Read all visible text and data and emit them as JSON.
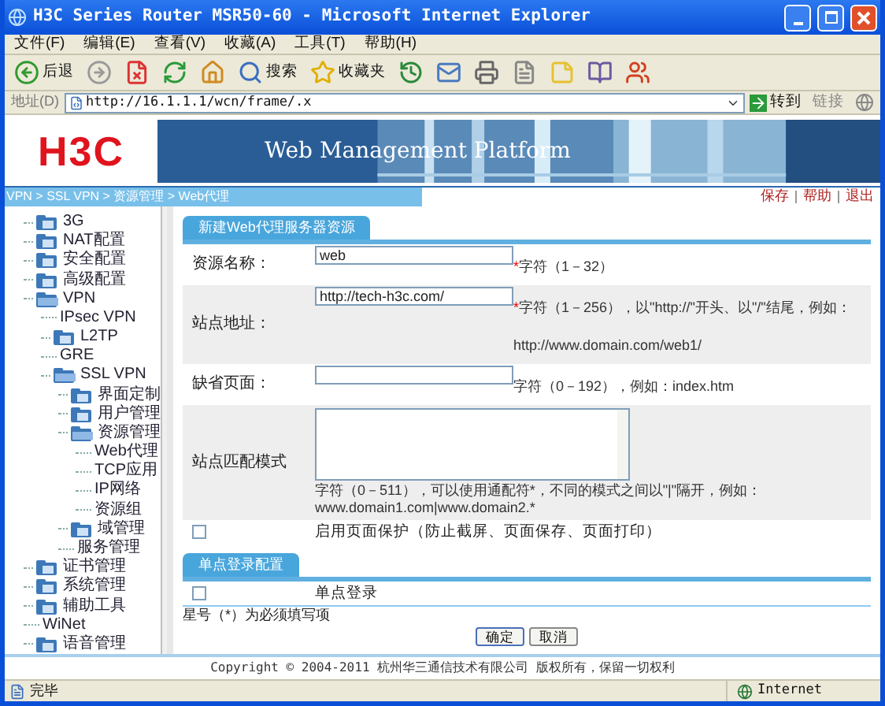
{
  "window": {
    "title": "H3C Series Router MSR50-60 - Microsoft Internet Explorer"
  },
  "menu": [
    "文件(F)",
    "编辑(E)",
    "查看(V)",
    "收藏(A)",
    "工具(T)",
    "帮助(H)"
  ],
  "toolbar": [
    {
      "kind": "back",
      "label": "后退"
    },
    {
      "kind": "forward"
    },
    {
      "kind": "stop"
    },
    {
      "kind": "refresh"
    },
    {
      "kind": "home"
    },
    {
      "kind": "search",
      "label": "搜索"
    },
    {
      "kind": "favorites",
      "label": "收藏夹"
    },
    {
      "kind": "history"
    },
    {
      "kind": "mail"
    },
    {
      "kind": "print"
    },
    {
      "kind": "edit"
    },
    {
      "kind": "note"
    },
    {
      "kind": "research"
    },
    {
      "kind": "messenger"
    }
  ],
  "address_bar": {
    "label": "地址(D)",
    "url": "http://16.1.1.1/wcn/frame/.x",
    "go": "转到",
    "links": "链接"
  },
  "banner": {
    "logo": "H3C",
    "title": "Web Management Platform"
  },
  "breadcrumb": "VPN > SSL VPN > 资源管理 > Web代理",
  "top_links": [
    "保存",
    "帮助",
    "退出"
  ],
  "tree": [
    {
      "label": "3G",
      "kind": "folder"
    },
    {
      "label": "NAT配置",
      "kind": "folder"
    },
    {
      "label": "安全配置",
      "kind": "folder"
    },
    {
      "label": "高级配置",
      "kind": "folder"
    },
    {
      "label": "VPN",
      "kind": "folder",
      "children": [
        {
          "label": "IPsec VPN",
          "kind": "leaf"
        },
        {
          "label": "L2TP",
          "kind": "folder"
        },
        {
          "label": "GRE",
          "kind": "leaf"
        },
        {
          "label": "SSL VPN",
          "kind": "folder",
          "children": [
            {
              "label": "界面定制",
              "kind": "folder"
            },
            {
              "label": "用户管理",
              "kind": "folder"
            },
            {
              "label": "资源管理",
              "kind": "folder",
              "children": [
                {
                  "label": "Web代理",
                  "kind": "leaf"
                },
                {
                  "label": "TCP应用",
                  "kind": "leaf"
                },
                {
                  "label": "IP网络",
                  "kind": "leaf"
                },
                {
                  "label": "资源组",
                  "kind": "leaf"
                }
              ]
            },
            {
              "label": "域管理",
              "kind": "folder"
            },
            {
              "label": "服务管理",
              "kind": "leaf"
            }
          ]
        }
      ]
    },
    {
      "label": "证书管理",
      "kind": "folder"
    },
    {
      "label": "系统管理",
      "kind": "folder"
    },
    {
      "label": "辅助工具",
      "kind": "folder"
    },
    {
      "label": "WiNet",
      "kind": "leaf"
    },
    {
      "label": "语音管理",
      "kind": "folder"
    }
  ],
  "form": {
    "tab": "新建Web代理服务器资源",
    "rows": [
      {
        "kind": "text",
        "label": "资源名称：",
        "value": "web",
        "required_mark": "*",
        "hint": "字符（1－32）"
      },
      {
        "kind": "text",
        "label": "站点地址：",
        "value": "http://tech-h3c.com/",
        "required_mark": "*",
        "hint": "字符（1－256），以\"http://\"开头、以\"/\"结尾，例如：http://www.domain.com/web1/"
      },
      {
        "kind": "text",
        "label": "缺省页面：",
        "hint": "字符（0－192），例如：index.htm"
      },
      {
        "kind": "textarea",
        "label": "站点匹配模式",
        "hint": "字符（0－511），可以使用通配符*，不同的模式之间以\"|\"隔开，例如：www.domain1.com|www.domain2.*"
      },
      {
        "kind": "checkbox",
        "checked": false,
        "label": "启用页面保护（防止截屏、页面保存、页面打印）"
      }
    ]
  },
  "sso": {
    "tab": "单点登录配置",
    "rows": [
      {
        "kind": "checkbox",
        "checked": false,
        "label": "单点登录"
      }
    ]
  },
  "note": "星号（*）为必须填写项",
  "buttons": [
    "确定",
    "取消"
  ],
  "footer": "Copyright © 2004-2011 杭州华三通信技术有限公司 版权所有，保留一切权利",
  "status_bar": {
    "text": "完毕",
    "zone": "Internet"
  }
}
